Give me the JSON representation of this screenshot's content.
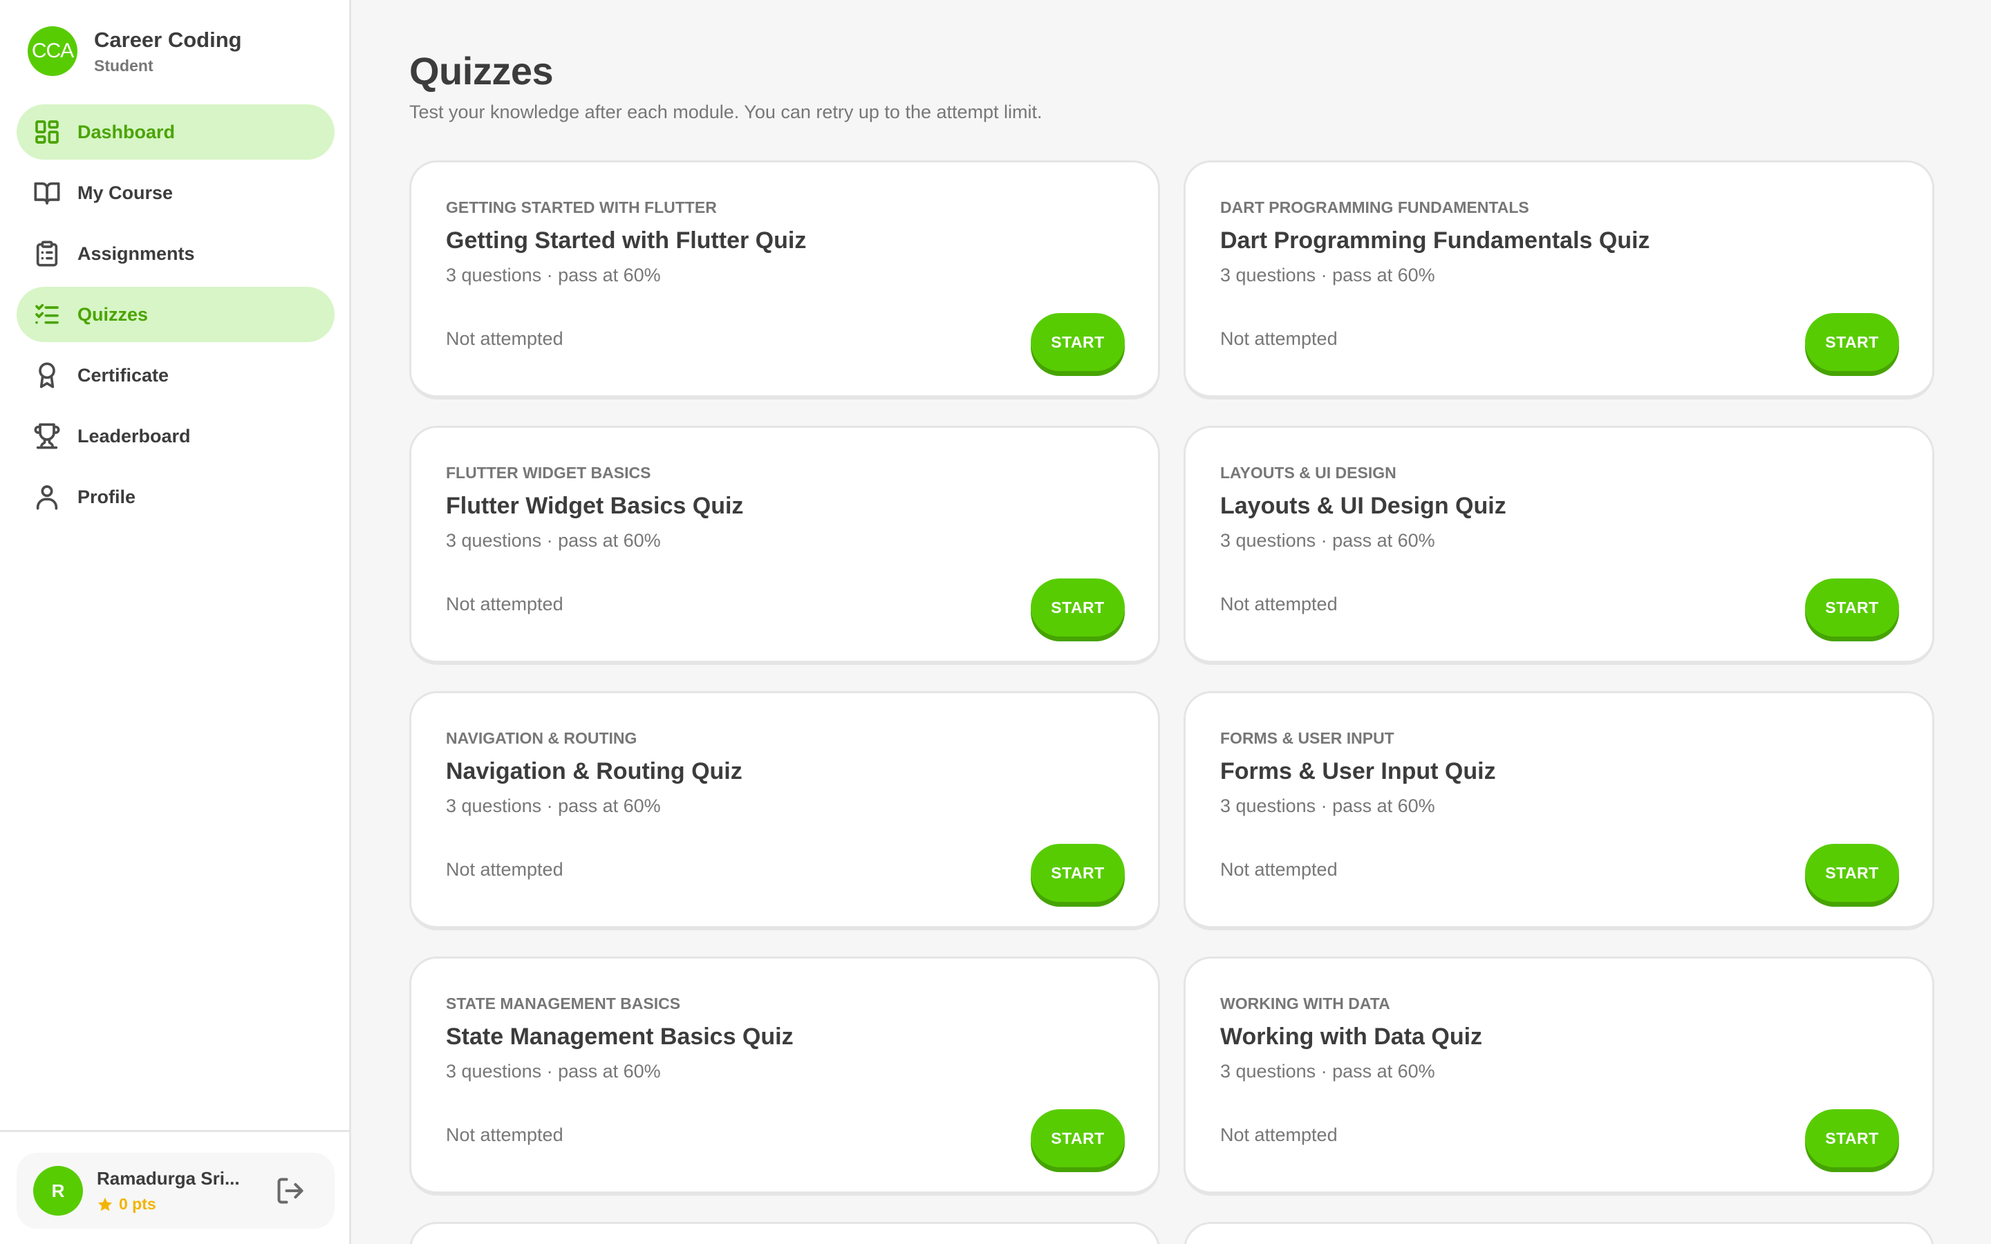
{
  "brand": {
    "logo_text": "CCA",
    "name": "Career Coding",
    "role": "Student"
  },
  "nav": [
    {
      "label": "Dashboard",
      "icon": "dashboard-icon"
    },
    {
      "label": "My Course",
      "icon": "book-icon"
    },
    {
      "label": "Assignments",
      "icon": "clipboard-icon"
    },
    {
      "label": "Quizzes",
      "icon": "checklist-icon"
    },
    {
      "label": "Certificate",
      "icon": "award-icon"
    },
    {
      "label": "Leaderboard",
      "icon": "trophy-icon"
    },
    {
      "label": "Profile",
      "icon": "user-icon"
    }
  ],
  "user": {
    "initial": "R",
    "name": "Ramadurga Sri...",
    "points": "0 pts"
  },
  "page": {
    "title": "Quizzes",
    "subtitle": "Test your knowledge after each module. You can retry up to the attempt limit."
  },
  "quizzes": [
    {
      "module": "GETTING STARTED WITH FLUTTER",
      "title": "Getting Started with Flutter Quiz",
      "meta": "3 questions · pass at 60%",
      "status": "Not attempted",
      "action": "START"
    },
    {
      "module": "DART PROGRAMMING FUNDAMENTALS",
      "title": "Dart Programming Fundamentals Quiz",
      "meta": "3 questions · pass at 60%",
      "status": "Not attempted",
      "action": "START"
    },
    {
      "module": "FLUTTER WIDGET BASICS",
      "title": "Flutter Widget Basics Quiz",
      "meta": "3 questions · pass at 60%",
      "status": "Not attempted",
      "action": "START"
    },
    {
      "module": "LAYOUTS & UI DESIGN",
      "title": "Layouts & UI Design Quiz",
      "meta": "3 questions · pass at 60%",
      "status": "Not attempted",
      "action": "START"
    },
    {
      "module": "NAVIGATION & ROUTING",
      "title": "Navigation & Routing Quiz",
      "meta": "3 questions · pass at 60%",
      "status": "Not attempted",
      "action": "START"
    },
    {
      "module": "FORMS & USER INPUT",
      "title": "Forms & User Input Quiz",
      "meta": "3 questions · pass at 60%",
      "status": "Not attempted",
      "action": "START"
    },
    {
      "module": "STATE MANAGEMENT BASICS",
      "title": "State Management Basics Quiz",
      "meta": "3 questions · pass at 60%",
      "status": "Not attempted",
      "action": "START"
    },
    {
      "module": "WORKING WITH DATA",
      "title": "Working with Data Quiz",
      "meta": "3 questions · pass at 60%",
      "status": "Not attempted",
      "action": "START"
    }
  ],
  "colors": {
    "accent": "#58cc02",
    "accent_dark": "#46a302",
    "active_bg": "#d7f5c6",
    "points": "#f2b400"
  }
}
